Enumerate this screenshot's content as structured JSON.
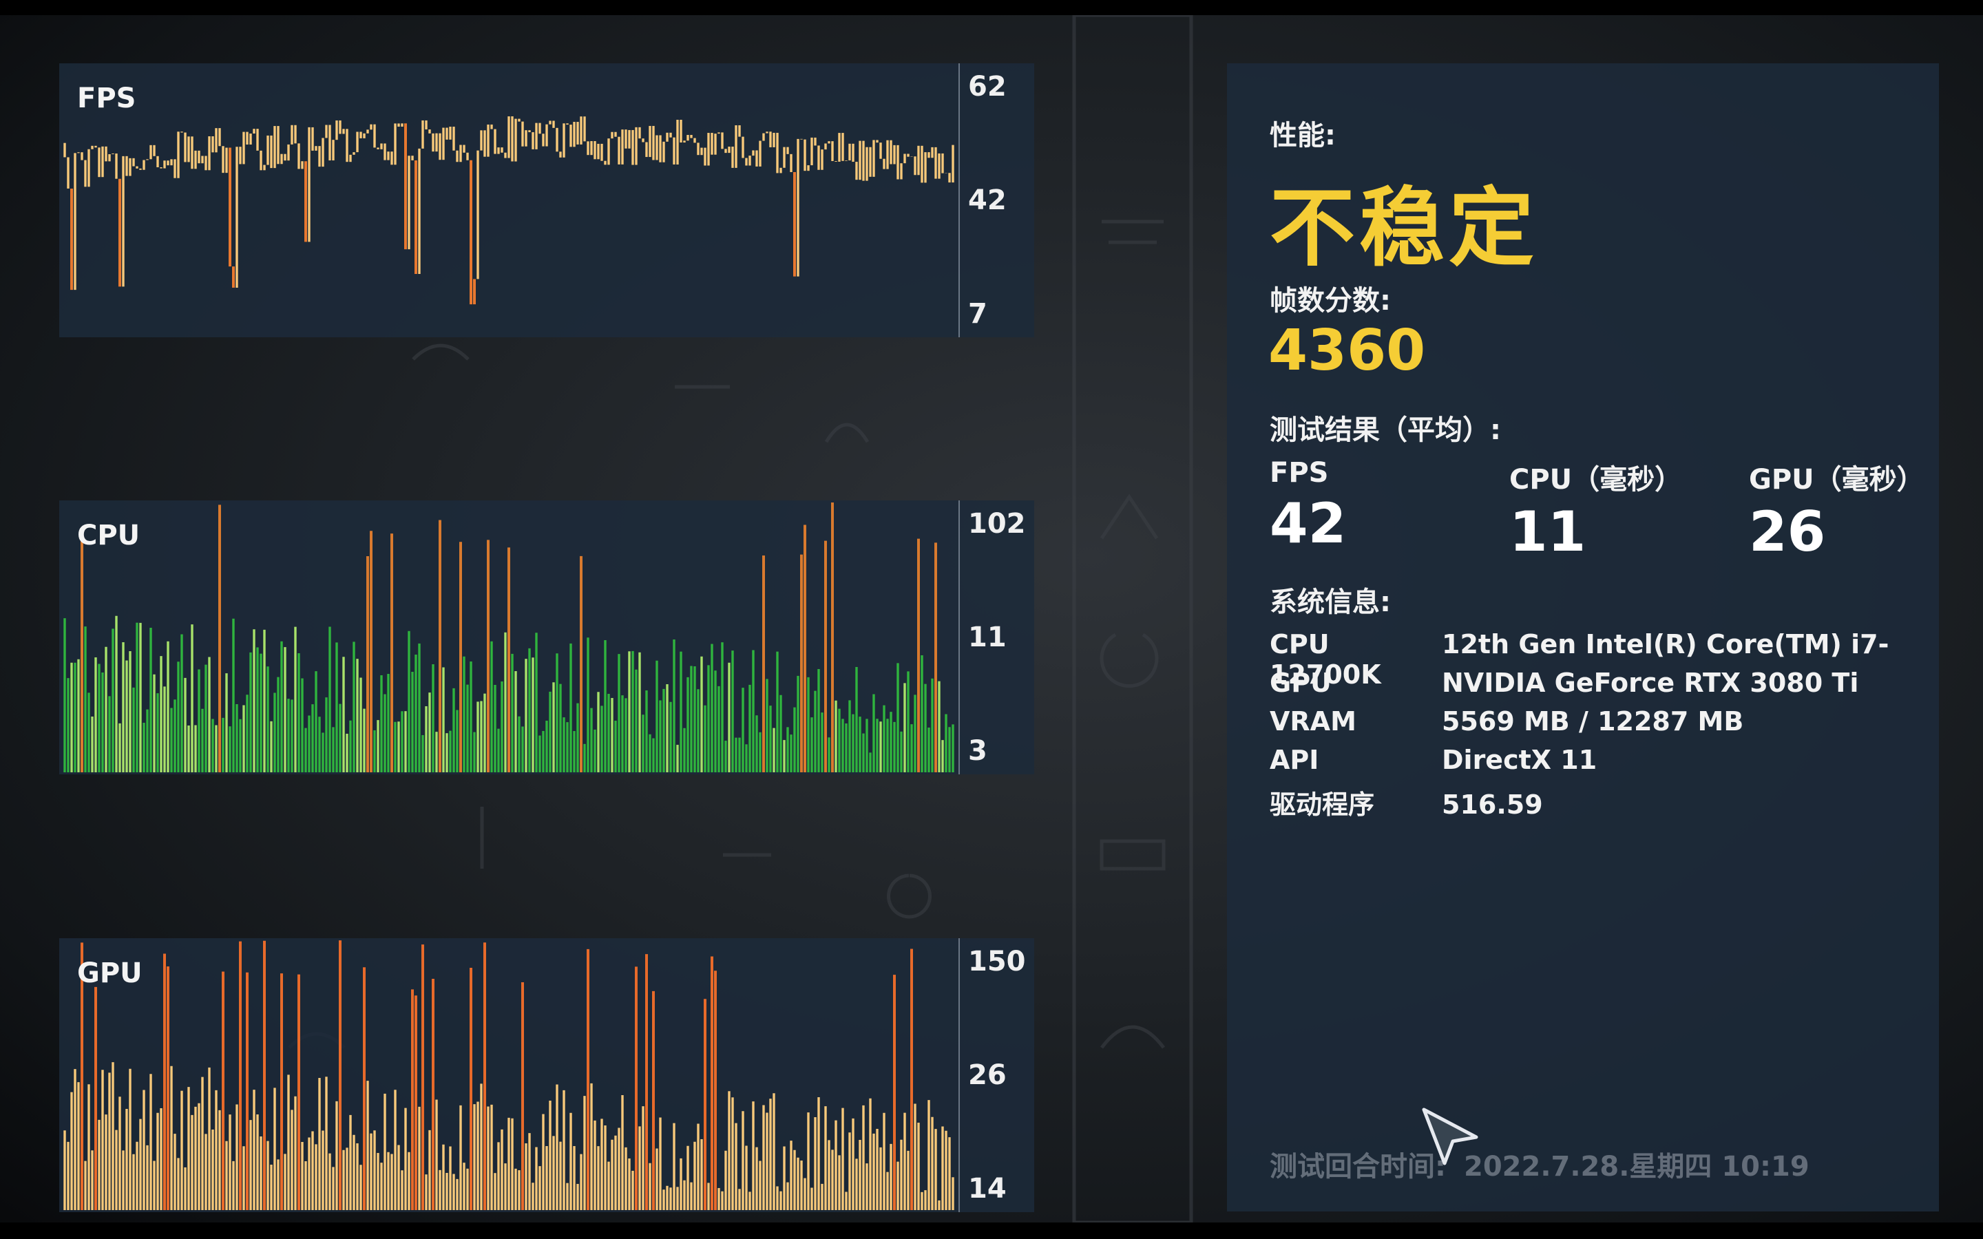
{
  "graphs": [
    {
      "id": "fps",
      "title": "FPS",
      "ticks": [
        "62",
        "42",
        "7"
      ]
    },
    {
      "id": "cpu",
      "title": "CPU",
      "ticks": [
        "102",
        "11",
        "3"
      ]
    },
    {
      "id": "gpu",
      "title": "GPU",
      "ticks": [
        "150",
        "26",
        "14"
      ]
    }
  ],
  "summary": {
    "performance_label": "性能:",
    "performance_value": "不稳定",
    "score_label": "帧数分数:",
    "score_value": "4360",
    "result_label": "测试结果（平均）:",
    "results": [
      {
        "label": "FPS",
        "value": "42"
      },
      {
        "label": "CPU（毫秒）",
        "value": "11"
      },
      {
        "label": "GPU（毫秒）",
        "value": "26"
      }
    ],
    "system_label": "系统信息:",
    "system": [
      {
        "key": "CPU",
        "value": "12th Gen Intel(R) Core(TM) i7-12700K"
      },
      {
        "key": "GPU",
        "value": "NVIDIA GeForce RTX 3080 Ti"
      },
      {
        "key": "VRAM",
        "value": "5569 MB / 12287 MB"
      },
      {
        "key": "API",
        "value": "DirectX 11"
      },
      {
        "key": "驱动程序",
        "value": "516.59"
      }
    ],
    "test_time_label": "测试回合时间:",
    "test_time_value": "2022.7.28.星期四 10:19"
  },
  "colors": {
    "accent_yellow": "#f5cd35",
    "fps_bar": "#f7c97a",
    "fps_spike": "#e8782f",
    "cpu_bar": "#2fb43e",
    "cpu_bar_light": "#a8e26a",
    "cpu_spike": "#d97a2e",
    "gpu_bar": "#f7c97a",
    "gpu_spike": "#e86a2a",
    "panel_bg": "#1d2a3a"
  },
  "icons": {
    "cursor": "mouse-pointer-icon"
  }
}
